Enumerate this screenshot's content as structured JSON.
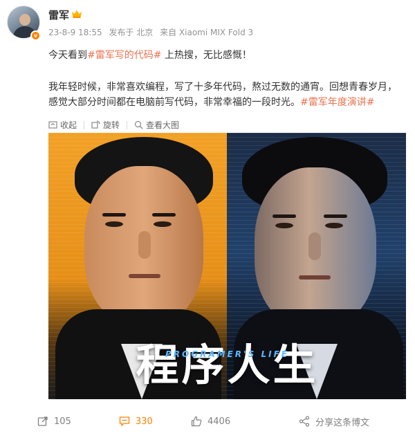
{
  "post": {
    "author": "雷军",
    "date": "23-8-9 18:55",
    "published_from": "发布于 北京",
    "device": "来自 Xiaomi MIX Fold 3",
    "line1_prefix": "今天看到",
    "line1_topic": "#雷军写的代码#",
    "line1_suffix": " 上热搜，无比感慨！",
    "line2": "我年轻时候，非常喜欢编程，写了十多年代码，熬过无数的通宵。回想青春岁月，",
    "line3_prefix": "感觉大部分时间都在电脑前写代码，非常幸福的一段时光。",
    "line3_topic": "#雷军年度演讲#"
  },
  "image_tools": {
    "collect": "收起",
    "rotate": "旋转",
    "view_large": "查看大图"
  },
  "poster": {
    "title": "程序人生",
    "subtitle": "PROGRAMER'S LIFE"
  },
  "actions": {
    "repost_count": "105",
    "comment_count": "330",
    "like_count": "4406",
    "share_label": "分享这条博文"
  },
  "colors": {
    "topic": "#eb7350",
    "accent": "#ff8200",
    "meta": "#939393"
  }
}
